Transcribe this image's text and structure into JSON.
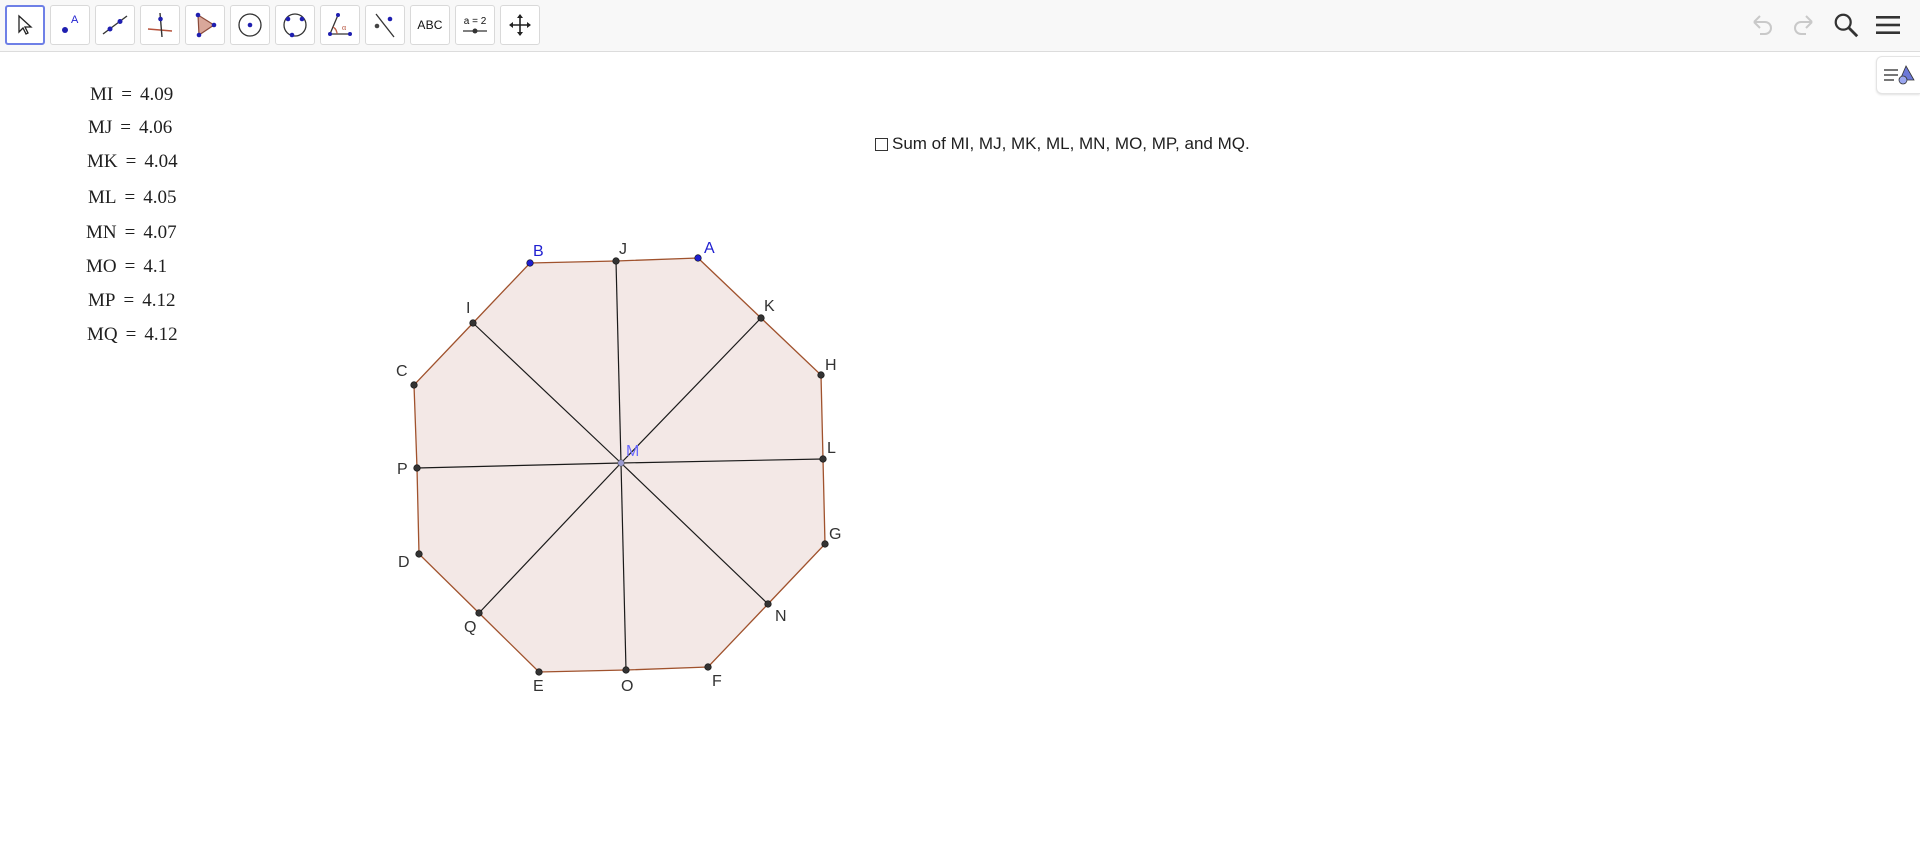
{
  "toolbar": {
    "tools": [
      {
        "name": "move-tool",
        "icon": "pointer-arrow-icon"
      },
      {
        "name": "point-tool",
        "icon": "point-icon"
      },
      {
        "name": "line-tool",
        "icon": "line-icon"
      },
      {
        "name": "perpendicular-line-tool",
        "icon": "perpendicular-icon"
      },
      {
        "name": "polygon-tool",
        "icon": "polygon-icon"
      },
      {
        "name": "circle-center-point-tool",
        "icon": "circle-center-icon"
      },
      {
        "name": "circle-three-points-tool",
        "icon": "circle-three-points-icon"
      },
      {
        "name": "angle-tool",
        "icon": "angle-icon"
      },
      {
        "name": "reflect-line-tool",
        "icon": "reflect-icon"
      },
      {
        "name": "text-tool",
        "label": "ABC"
      },
      {
        "name": "slider-tool",
        "label": "a = 2"
      },
      {
        "name": "move-graphics-view-tool",
        "icon": "move-view-icon"
      }
    ],
    "right": {
      "undo": "undo-icon",
      "redo": "redo-icon",
      "search": "search-icon",
      "menu": "menu-icon"
    }
  },
  "measurements": [
    {
      "label": "MI",
      "value": "4.09"
    },
    {
      "label": "MJ",
      "value": "4.06"
    },
    {
      "label": "MK",
      "value": "4.04"
    },
    {
      "label": "ML",
      "value": "4.05"
    },
    {
      "label": "MN",
      "value": "4.07"
    },
    {
      "label": "MO",
      "value": "4.1"
    },
    {
      "label": "MP",
      "value": "4.12"
    },
    {
      "label": "MQ",
      "value": "4.12"
    }
  ],
  "checkbox": {
    "label": "Sum of MI, MJ, MK, ML, MN, MO, MP, and MQ.",
    "checked": false
  },
  "geometry": {
    "center_label": "M",
    "free_point_labels": [
      "A",
      "B"
    ],
    "polygon_vertex_labels": [
      "A",
      "K",
      "H",
      "L",
      "G",
      "N",
      "F",
      "O",
      "E",
      "Q",
      "D",
      "P",
      "C",
      "I",
      "B",
      "J"
    ],
    "segment_endpoints": [
      "I",
      "J",
      "K",
      "L",
      "N",
      "O",
      "P",
      "Q"
    ],
    "colors": {
      "polygon_fill": "#f3e8e6",
      "polygon_edge": "#a0522d",
      "free_point": "#1f1fd0",
      "segment": "#1a1a1a",
      "center_label": "#6a6aff"
    }
  }
}
